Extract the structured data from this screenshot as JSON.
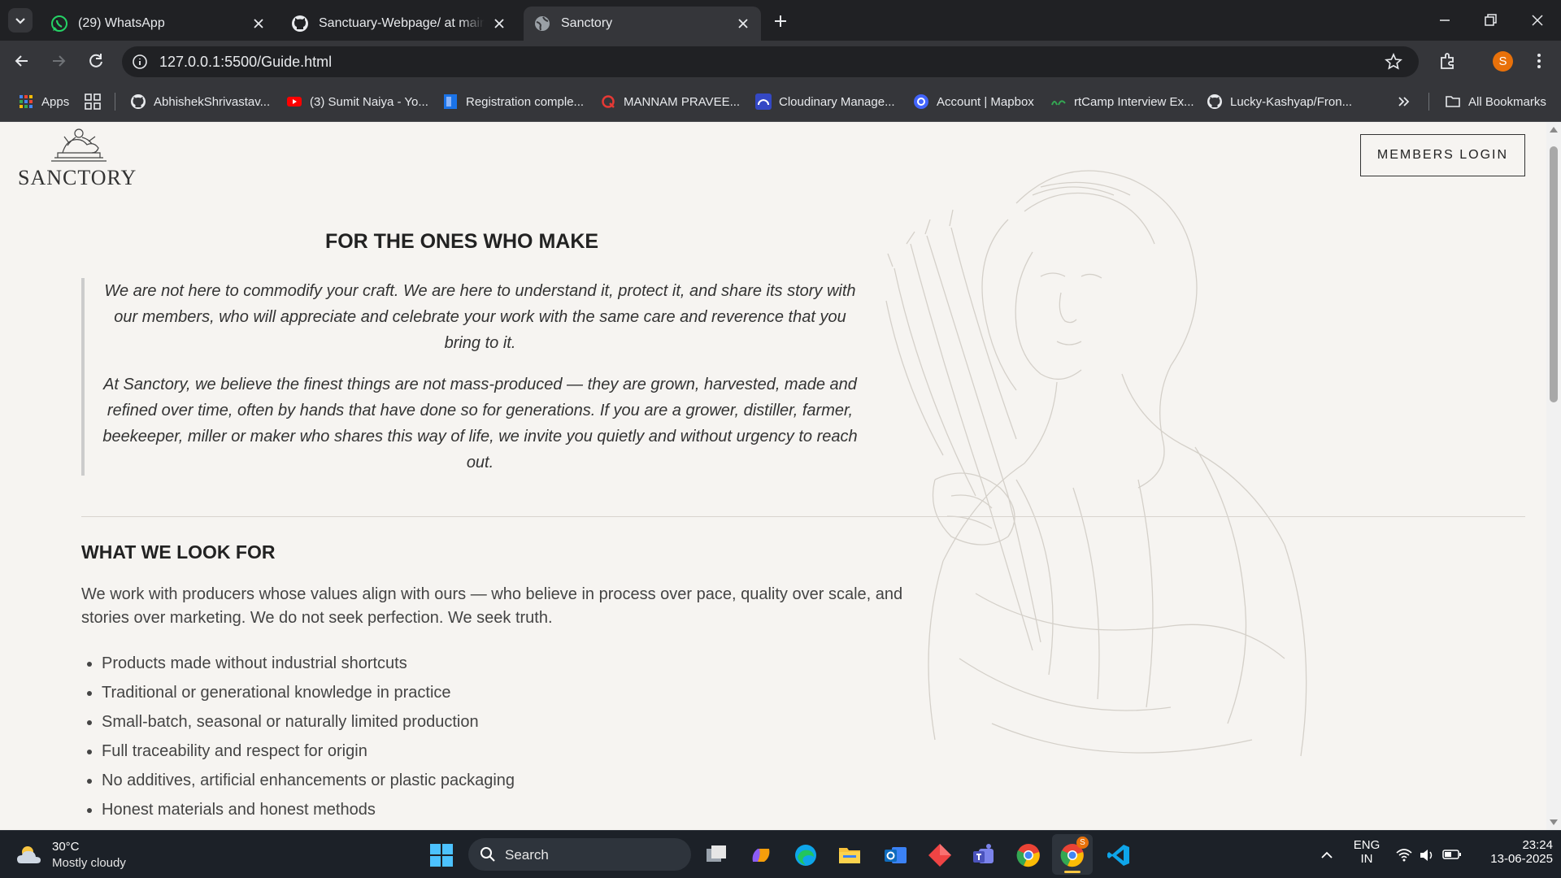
{
  "browser": {
    "tabs": [
      {
        "title": "(29) WhatsApp",
        "icon": "whatsapp-icon",
        "active": false
      },
      {
        "title": "Sanctuary-Webpage/ at main · S",
        "icon": "github-icon",
        "active": false
      },
      {
        "title": "Sanctory",
        "icon": "globe-icon",
        "active": true
      }
    ],
    "url": "127.0.0.1:5500/Guide.html",
    "profile_initial": "S",
    "bookmarks": [
      {
        "label": "Apps",
        "icon": "apps-grid-icon"
      },
      {
        "label": "AbhishekShrivastav...",
        "icon": "github-icon"
      },
      {
        "label": "(3) Sumit Naiya - Yo...",
        "icon": "youtube-icon"
      },
      {
        "label": "Registration comple...",
        "icon": "page-icon"
      },
      {
        "label": "MANNAM PRAVEE...",
        "icon": "q-icon"
      },
      {
        "label": "Cloudinary Manage...",
        "icon": "cloudinary-icon"
      },
      {
        "label": "Account | Mapbox",
        "icon": "mapbox-icon"
      },
      {
        "label": "rtCamp Interview Ex...",
        "icon": "rtcamp-icon"
      },
      {
        "label": "Lucky-Kashyap/Fron...",
        "icon": "github-icon"
      }
    ],
    "all_bookmarks": "All Bookmarks",
    "colors": {
      "profile": "#e8710a"
    }
  },
  "site": {
    "logo_text": "SANCTORY",
    "login_label": "MEMBERS LOGIN",
    "hero_title": "FOR THE ONES WHO MAKE",
    "quote_p1": "We are not here to commodify your craft. We are here to understand it, protect it, and share its story with our members, who will appreciate and celebrate your work with the same care and reverence that you bring to it.",
    "quote_p2": "At Sanctory, we believe the finest things are not mass-produced — they are grown, harvested, made and refined over time, often by hands that have done so for generations. If you are a grower, distiller, farmer, beekeeper, miller or maker who shares this way of life, we invite you quietly and without urgency to reach out.",
    "look_title": "WHAT WE LOOK FOR",
    "look_intro": "We work with producers whose values align with ours — who believe in process over pace, quality over scale, and stories over marketing. We do not seek perfection. We seek truth.",
    "look_items": [
      "Products made without industrial shortcuts",
      "Traditional or generational knowledge in practice",
      "Small-batch, seasonal or naturally limited production",
      "Full traceability and respect for origin",
      "No additives, artificial enhancements or plastic packaging",
      "Honest materials and honest methods"
    ]
  },
  "taskbar": {
    "weather_temp": "30°C",
    "weather_desc": "Mostly cloudy",
    "search_label": "Search",
    "lang_1": "ENG",
    "lang_2": "IN",
    "time": "23:24",
    "date": "13-06-2025",
    "notification_badge": "S"
  }
}
